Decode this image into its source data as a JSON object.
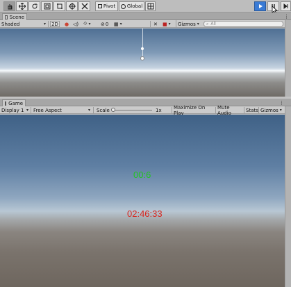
{
  "toolbar": {
    "tools": [
      "hand-icon",
      "move-icon",
      "rotate-icon",
      "scale-icon",
      "rect-icon",
      "transform-icon",
      "custom-tool-icon"
    ],
    "pivot_label": "Pivot",
    "global_label": "Global",
    "play_color": "#3a7bd5"
  },
  "scene_tab": {
    "label": "Scene"
  },
  "scene_bar": {
    "shading": "Shaded",
    "mode_2d": "2D",
    "hidden_count": "0",
    "gizmos": "Gizmos",
    "search_placeholder": "All"
  },
  "game_tab": {
    "label": "Game"
  },
  "game_bar": {
    "display": "Display 1",
    "aspect": "Free Aspect",
    "scale_label": "Scale",
    "scale_value": "1x",
    "maximize": "Maximize On Play",
    "mute": "Mute Audio",
    "stats": "Stats",
    "gizmos": "Gizmos"
  },
  "game_view": {
    "timer_green": "00:6",
    "timer_red": "02:46:33",
    "green_color": "#22c51f",
    "red_color": "#d8261e"
  }
}
